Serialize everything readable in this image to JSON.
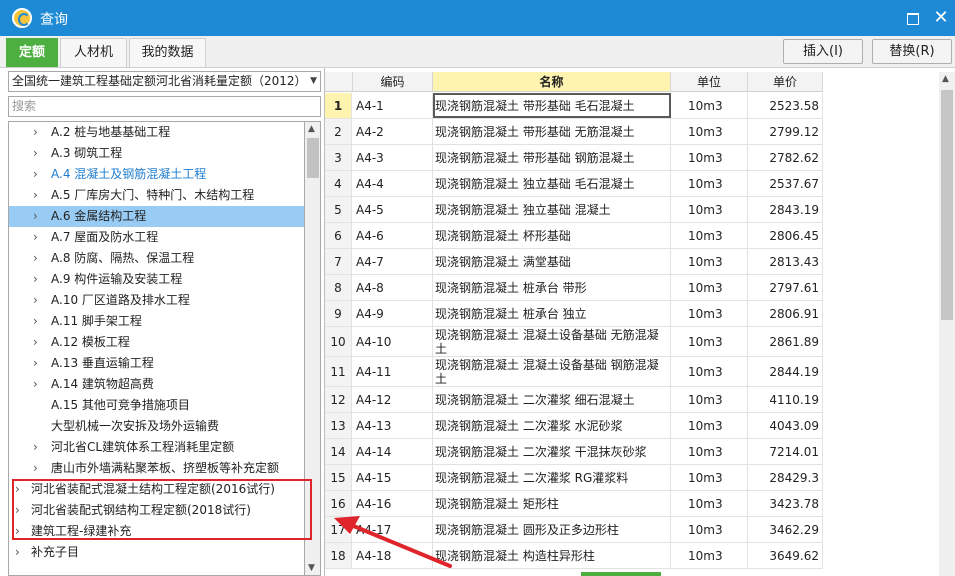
{
  "window": {
    "title": "查询"
  },
  "tabs": [
    {
      "label": "定额"
    },
    {
      "label": "人材机"
    },
    {
      "label": "我的数据"
    }
  ],
  "toolbar": {
    "insert_label": "插入(I)",
    "replace_label": "替换(R)"
  },
  "library_select": {
    "value": "全国统一建筑工程基础定额河北省消耗量定额（2012）"
  },
  "search": {
    "placeholder": "搜索"
  },
  "tree": [
    {
      "label": "A.2 桩与地基基础工程"
    },
    {
      "label": "A.3 砌筑工程"
    },
    {
      "label": "A.4 混凝土及钢筋混凝土工程"
    },
    {
      "label": "A.5 厂库房大门、特种门、木结构工程"
    },
    {
      "label": "A.6 金属结构工程"
    },
    {
      "label": "A.7 屋面及防水工程"
    },
    {
      "label": "A.8 防腐、隔热、保温工程"
    },
    {
      "label": "A.9 构件运输及安装工程"
    },
    {
      "label": "A.10 厂区道路及排水工程"
    },
    {
      "label": "A.11 脚手架工程"
    },
    {
      "label": "A.12 模板工程"
    },
    {
      "label": "A.13 垂直运输工程"
    },
    {
      "label": "A.14 建筑物超高费"
    },
    {
      "label": "A.15 其他可竞争措施项目"
    },
    {
      "label": "大型机械一次安拆及场外运输费"
    },
    {
      "label": "河北省CL建筑体系工程消耗里定额"
    },
    {
      "label": "唐山市外墙满粘聚苯板、挤塑板等补充定额"
    },
    {
      "label": "河北省装配式混凝土结构工程定额(2016试行)"
    },
    {
      "label": "河北省装配式钢结构工程定额(2018试行)"
    },
    {
      "label": "建筑工程-绿建补充"
    },
    {
      "label": "补充子目"
    }
  ],
  "table": {
    "headers": {
      "code": "编码",
      "name": "名称",
      "unit": "单位",
      "price": "单价"
    },
    "rows": [
      {
        "idx": "1",
        "code": "A4-1",
        "name": "现浇钢筋混凝土 带形基础 毛石混凝土",
        "unit": "10m3",
        "price": "2523.58"
      },
      {
        "idx": "2",
        "code": "A4-2",
        "name": "现浇钢筋混凝土 带形基础 无筋混凝土",
        "unit": "10m3",
        "price": "2799.12"
      },
      {
        "idx": "3",
        "code": "A4-3",
        "name": "现浇钢筋混凝土 带形基础 钢筋混凝土",
        "unit": "10m3",
        "price": "2782.62"
      },
      {
        "idx": "4",
        "code": "A4-4",
        "name": "现浇钢筋混凝土 独立基础 毛石混凝土",
        "unit": "10m3",
        "price": "2537.67"
      },
      {
        "idx": "5",
        "code": "A4-5",
        "name": "现浇钢筋混凝土 独立基础 混凝土",
        "unit": "10m3",
        "price": "2843.19"
      },
      {
        "idx": "6",
        "code": "A4-6",
        "name": "现浇钢筋混凝土 杯形基础",
        "unit": "10m3",
        "price": "2806.45"
      },
      {
        "idx": "7",
        "code": "A4-7",
        "name": "现浇钢筋混凝土 满堂基础",
        "unit": "10m3",
        "price": "2813.43"
      },
      {
        "idx": "8",
        "code": "A4-8",
        "name": "现浇钢筋混凝土 桩承台 带形",
        "unit": "10m3",
        "price": "2797.61"
      },
      {
        "idx": "9",
        "code": "A4-9",
        "name": "现浇钢筋混凝土 桩承台 独立",
        "unit": "10m3",
        "price": "2806.91"
      },
      {
        "idx": "10",
        "code": "A4-10",
        "name": "现浇钢筋混凝土 混凝土设备基础 无筋混凝土",
        "unit": "10m3",
        "price": "2861.89"
      },
      {
        "idx": "11",
        "code": "A4-11",
        "name": "现浇钢筋混凝土 混凝土设备基础 钢筋混凝土",
        "unit": "10m3",
        "price": "2844.19"
      },
      {
        "idx": "12",
        "code": "A4-12",
        "name": "现浇钢筋混凝土 二次灌浆 细石混凝土",
        "unit": "10m3",
        "price": "4110.19"
      },
      {
        "idx": "13",
        "code": "A4-13",
        "name": "现浇钢筋混凝土 二次灌浆 水泥砂浆",
        "unit": "10m3",
        "price": "4043.09"
      },
      {
        "idx": "14",
        "code": "A4-14",
        "name": "现浇钢筋混凝土 二次灌浆 干混抹灰砂浆",
        "unit": "10m3",
        "price": "7214.01"
      },
      {
        "idx": "15",
        "code": "A4-15",
        "name": "现浇钢筋混凝土 二次灌浆 RG灌浆料",
        "unit": "10m3",
        "price": "28429.3"
      },
      {
        "idx": "16",
        "code": "A4-16",
        "name": "现浇钢筋混凝土 矩形柱",
        "unit": "10m3",
        "price": "3423.78"
      },
      {
        "idx": "17",
        "code": "A4-17",
        "name": "现浇钢筋混凝土 圆形及正多边形柱",
        "unit": "10m3",
        "price": "3462.29"
      },
      {
        "idx": "18",
        "code": "A4-18",
        "name": "现浇钢筋混凝土 构造柱异形柱",
        "unit": "10m3",
        "price": "3649.62"
      }
    ]
  },
  "colors": {
    "titlebar": "#1e8ad6",
    "active_tab": "#4caf3f",
    "selected": "#99ccf5",
    "annotation": "#e0242b"
  }
}
